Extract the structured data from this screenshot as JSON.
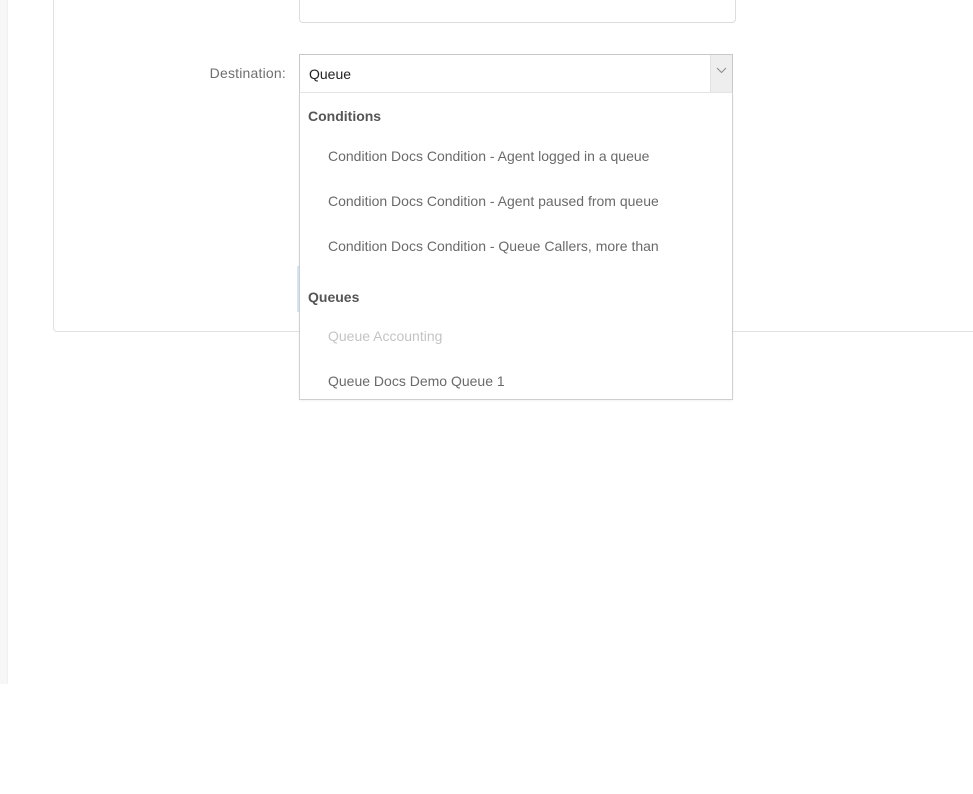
{
  "form": {
    "destination_label": "Destination:",
    "destination_value": "Queue"
  },
  "dropdown": {
    "groups": [
      {
        "label": "Conditions",
        "options": [
          {
            "label": "Condition Docs Condition - Agent logged in a queue",
            "disabled": false
          },
          {
            "label": "Condition Docs Condition - Agent paused from queue",
            "disabled": false
          },
          {
            "label": "Condition Docs Condition - Queue Callers, more than",
            "disabled": false
          }
        ]
      },
      {
        "label": "Queues",
        "options": [
          {
            "label": "Queue Accounting",
            "disabled": true
          },
          {
            "label": "Queue Docs Demo Queue 1",
            "disabled": false
          }
        ]
      }
    ]
  },
  "icons": {
    "select_arrow": "chevron-down-icon"
  }
}
